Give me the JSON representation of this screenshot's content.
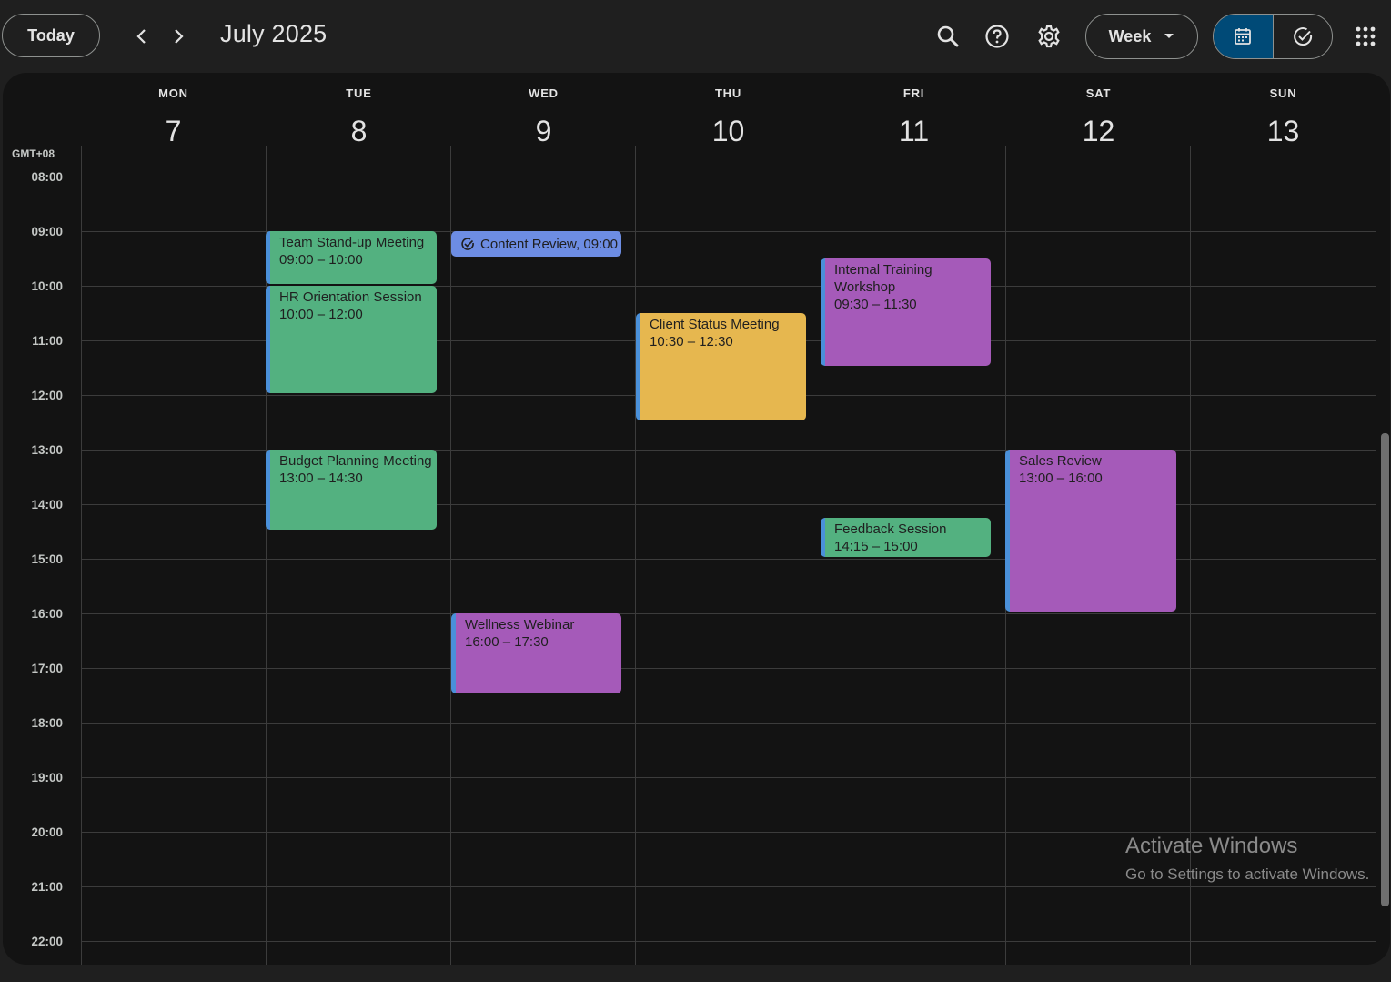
{
  "toolbar": {
    "today_label": "Today",
    "month_title": "July 2025",
    "view_label": "Week",
    "icons": [
      "chevron-left-icon",
      "chevron-right-icon",
      "search-icon",
      "help-icon",
      "settings-icon",
      "calendar-icon",
      "task-check-icon",
      "apps-grid-icon"
    ]
  },
  "timezone": "GMT+08",
  "days": [
    {
      "abbr": "MON",
      "num": "7"
    },
    {
      "abbr": "TUE",
      "num": "8"
    },
    {
      "abbr": "WED",
      "num": "9"
    },
    {
      "abbr": "THU",
      "num": "10"
    },
    {
      "abbr": "FRI",
      "num": "11"
    },
    {
      "abbr": "SAT",
      "num": "12"
    },
    {
      "abbr": "SUN",
      "num": "13"
    }
  ],
  "hours": [
    "08:00",
    "09:00",
    "10:00",
    "11:00",
    "12:00",
    "13:00",
    "14:00",
    "15:00",
    "16:00",
    "17:00",
    "18:00",
    "19:00",
    "20:00",
    "21:00",
    "22:00"
  ],
  "events": [
    {
      "title": "Team Stand-up Meeting",
      "time": "09:00 – 10:00",
      "color": "#53b180"
    },
    {
      "title": "HR Orientation Session",
      "time": "10:00 – 12:00",
      "color": "#53b180"
    },
    {
      "title": "Budget Planning Meeting",
      "time": "13:00 – 14:30",
      "color": "#53b180"
    },
    {
      "title": "Client Status Meeting",
      "time": "10:30 – 12:30",
      "color": "#e6b74f"
    },
    {
      "title": "Internal Training Workshop",
      "time": "09:30 – 11:30",
      "color": "#a55ab9"
    },
    {
      "title": "Feedback Session",
      "time": "14:15 – 15:00",
      "color": "#53b180"
    },
    {
      "title": "Sales Review",
      "time": "13:00 – 16:00",
      "color": "#a55ab9"
    },
    {
      "title": "Wellness Webinar",
      "time": "16:00 – 17:30",
      "color": "#a55ab9"
    }
  ],
  "task": {
    "label": "Content Review, 09:00",
    "color": "#6d8de3"
  },
  "watermark": {
    "line1": "Activate Windows",
    "line2": "Go to Settings to activate Windows."
  }
}
